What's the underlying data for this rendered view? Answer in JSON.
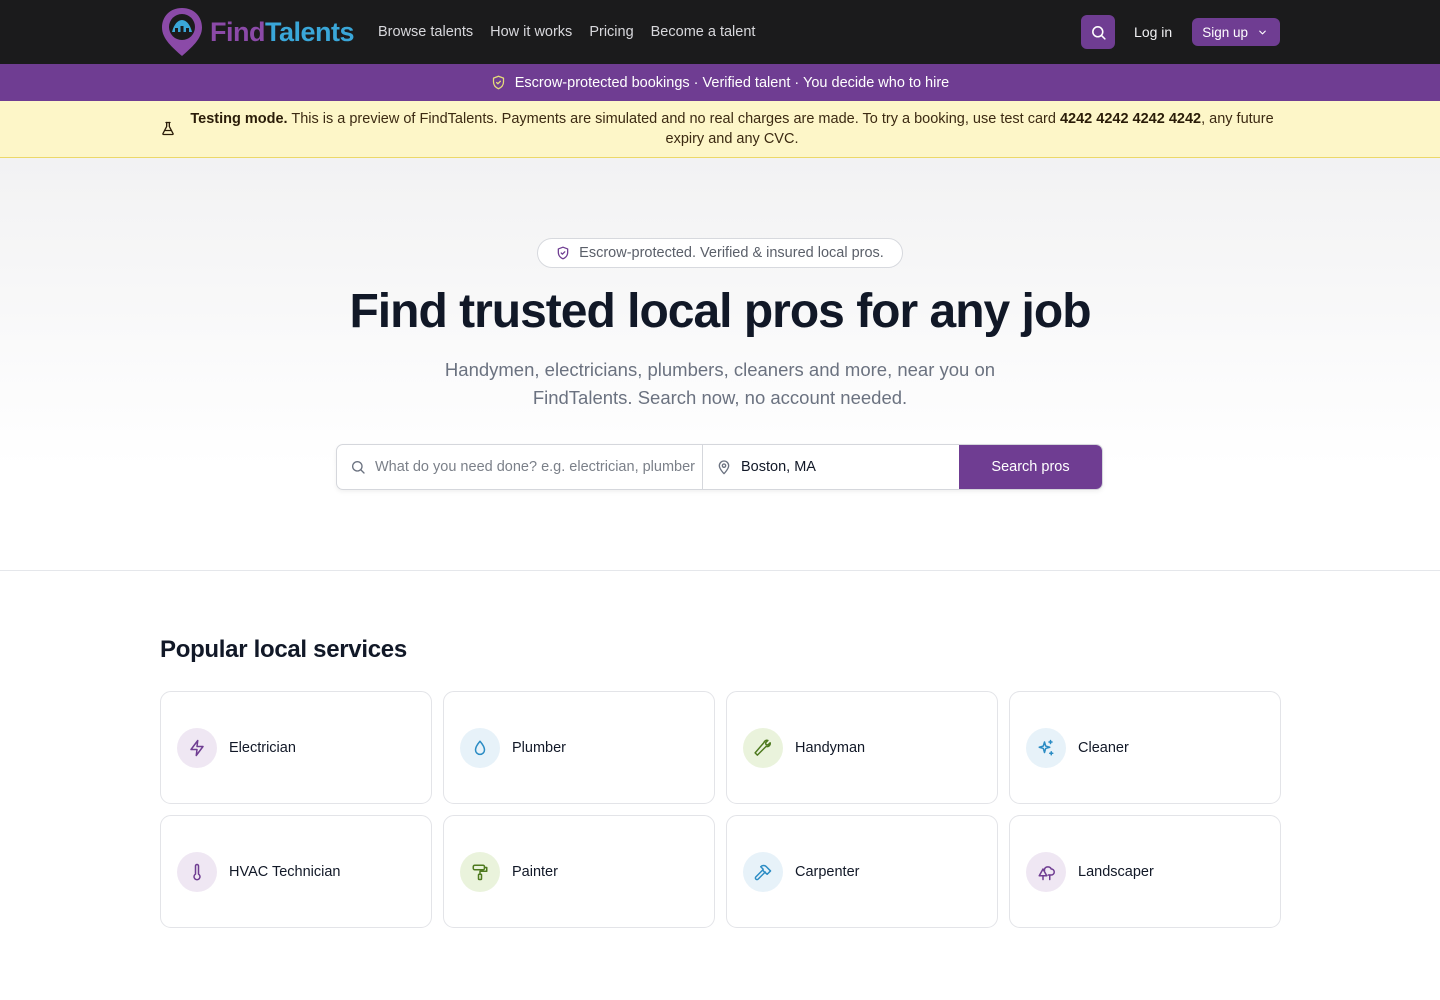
{
  "brand": {
    "find": "Find",
    "talents": "Talents"
  },
  "nav": {
    "links": [
      "Browse talents",
      "How it works",
      "Pricing",
      "Become a talent"
    ],
    "login": "Log in",
    "signup": "Sign up"
  },
  "promo": {
    "text": "Escrow-protected bookings · Verified talent · You decide who to hire"
  },
  "testing": {
    "label": "Testing mode.",
    "text_before": " This is a preview of FindTalents. Payments are simulated and no real charges are made. To try a booking, use test card ",
    "card": "4242 4242 4242 4242",
    "text_after": ", any future expiry and any CVC."
  },
  "hero": {
    "pill": "Escrow-protected. Verified & insured local pros.",
    "title": "Find trusted local pros for any job",
    "subtitle": "Handymen, electricians, plumbers, cleaners and more, near you on FindTalents. Search now, no account needed.",
    "search_placeholder": "What do you need done? e.g. electrician, plumber",
    "location_value": "Boston, MA",
    "search_button": "Search pros"
  },
  "services": {
    "title": "Popular local services",
    "items": [
      {
        "label": "Electrician",
        "icon": "lightning-icon",
        "bg": "#efe7f3",
        "color": "#6f3d92"
      },
      {
        "label": "Plumber",
        "icon": "droplet-icon",
        "bg": "#e7f2f9",
        "color": "#2b8cc4"
      },
      {
        "label": "Handyman",
        "icon": "wrench-icon",
        "bg": "#eaf3dc",
        "color": "#4e7a1f"
      },
      {
        "label": "Cleaner",
        "icon": "sparkles-icon",
        "bg": "#e7f2f9",
        "color": "#2b8cc4"
      },
      {
        "label": "HVAC Technician",
        "icon": "thermometer-icon",
        "bg": "#efe7f3",
        "color": "#6f3d92"
      },
      {
        "label": "Painter",
        "icon": "paint-roller-icon",
        "bg": "#eaf3dc",
        "color": "#4e7a1f"
      },
      {
        "label": "Carpenter",
        "icon": "hammer-icon",
        "bg": "#e7f2f9",
        "color": "#2b8cc4"
      },
      {
        "label": "Landscaper",
        "icon": "trees-icon",
        "bg": "#efe7f3",
        "color": "#6f3d92"
      }
    ]
  },
  "colors": {
    "brand_purple": "#6f3d92",
    "nav_bg": "#1b1b1c",
    "banner_bg": "#fdf6c8"
  }
}
